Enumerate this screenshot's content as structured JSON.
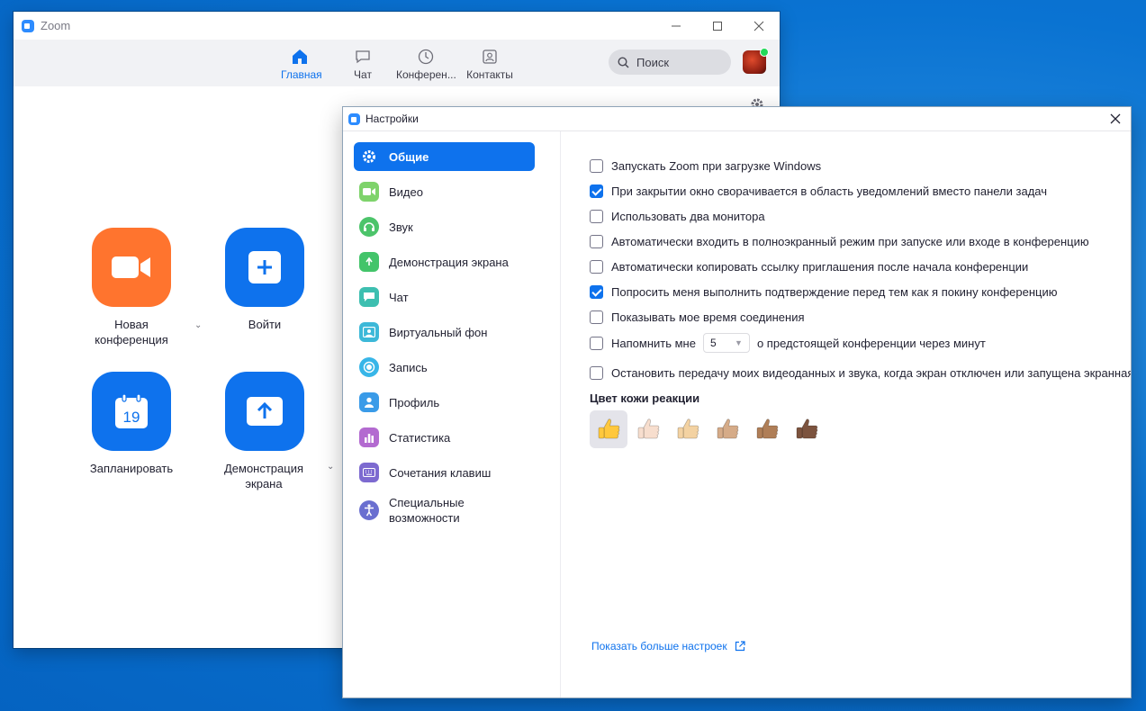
{
  "main_window": {
    "title": "Zoom",
    "nav": [
      {
        "label": "Главная",
        "icon": "home-icon",
        "active": true
      },
      {
        "label": "Чат",
        "icon": "chat-icon",
        "active": false
      },
      {
        "label": "Конферен...",
        "icon": "clock-icon",
        "active": false
      },
      {
        "label": "Контакты",
        "icon": "contacts-icon",
        "active": false
      }
    ],
    "search_placeholder": "Поиск",
    "tiles": [
      {
        "label": "Новая конференция",
        "icon": "video-camera-icon",
        "color": "#ff742e"
      },
      {
        "label": "Войти",
        "icon": "plus-icon",
        "color": "#0e72ed"
      },
      {
        "label": "Запланировать",
        "icon": "calendar-icon",
        "color": "#0e72ed",
        "calendar_day": "19"
      },
      {
        "label": "Демонстрация экрана",
        "icon": "share-arrow-icon",
        "color": "#0e72ed"
      }
    ]
  },
  "settings": {
    "title": "Настройки",
    "sidebar": [
      {
        "label": "Общие",
        "icon": "gear-icon",
        "color": "#0e72ed",
        "active": true
      },
      {
        "label": "Видео",
        "icon": "video-icon",
        "color": "#7ed36b"
      },
      {
        "label": "Звук",
        "icon": "headphones-icon",
        "color": "#4cc46a"
      },
      {
        "label": "Демонстрация экрана",
        "icon": "share-screen-icon",
        "color": "#43c46a"
      },
      {
        "label": "Чат",
        "icon": "chat-bubble-icon",
        "color": "#3dbfb0"
      },
      {
        "label": "Виртуальный фон",
        "icon": "virtual-background-icon",
        "color": "#3cb8d8"
      },
      {
        "label": "Запись",
        "icon": "record-icon",
        "color": "#38b6e8"
      },
      {
        "label": "Профиль",
        "icon": "profile-icon",
        "color": "#3a9be8"
      },
      {
        "label": "Статистика",
        "icon": "statistics-icon",
        "color": "#b36ad0"
      },
      {
        "label": "Сочетания клавиш",
        "icon": "keyboard-icon",
        "color": "#7d6ad0"
      },
      {
        "label": "Специальные возможности",
        "icon": "accessibility-icon",
        "color": "#6a6fd0"
      }
    ],
    "options": [
      {
        "label": "Запускать Zoom при загрузке Windows",
        "checked": false
      },
      {
        "label": "При закрытии окно сворачивается в область уведомлений вместо панели задач",
        "checked": true
      },
      {
        "label": "Использовать два монитора",
        "checked": false
      },
      {
        "label": "Автоматически входить в полноэкранный режим при запуске или входе в конференцию",
        "checked": false
      },
      {
        "label": "Автоматически копировать ссылку приглашения после начала конференции",
        "checked": false
      },
      {
        "label": "Попросить меня выполнить подтверждение перед тем как я покину конференцию",
        "checked": true
      },
      {
        "label": "Показывать мое время соединения",
        "checked": false
      }
    ],
    "reminder": {
      "before": "Напомнить мне",
      "value": "5",
      "after": "о предстоящей конференции через минут",
      "checked": false
    },
    "stop_video": {
      "label": "Остановить передачу моих видеоданных и звука, когда экран отключен или запущена экранная",
      "checked": false
    },
    "skin_tone_title": "Цвет кожи реакции",
    "skin_tones": [
      "#ffc83d",
      "#f7dece",
      "#f3d2a2",
      "#d5ab88",
      "#af7e57",
      "#7c533e"
    ],
    "selected_tone": 0,
    "more_settings_link": "Показать больше настроек"
  }
}
